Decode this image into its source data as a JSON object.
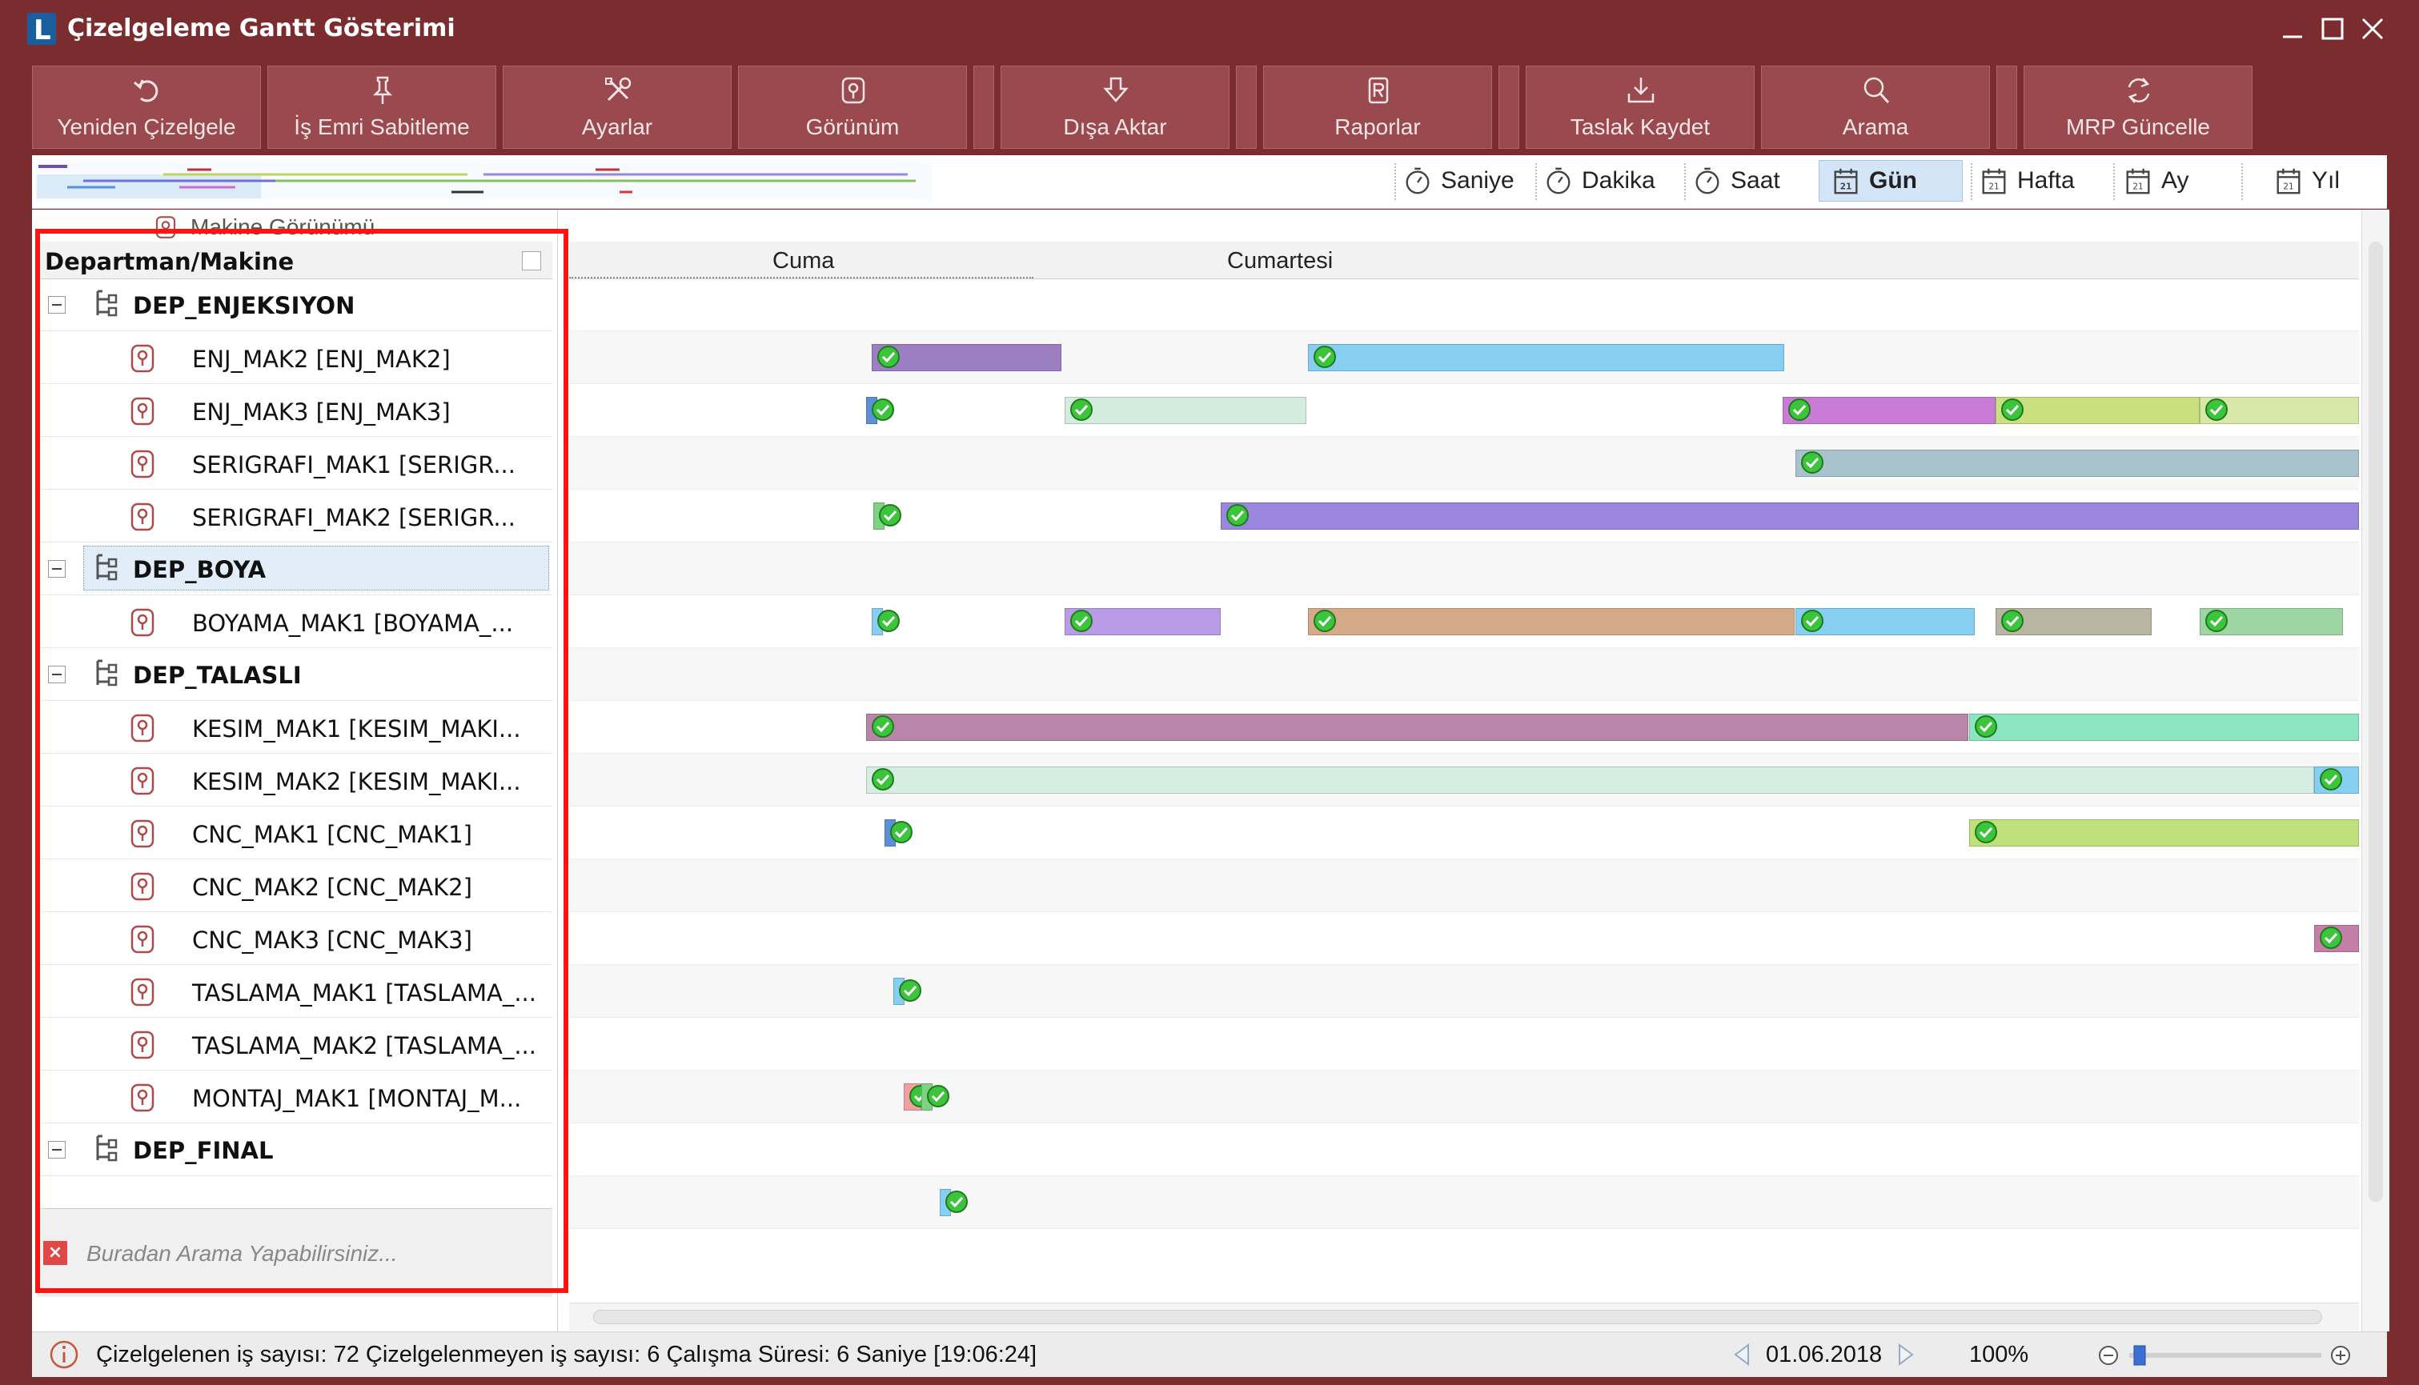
{
  "window": {
    "title": "Çizelgeleme Gantt Gösterimi",
    "logo_letter": "L"
  },
  "toolbar": {
    "buttons": [
      {
        "label": "Yeniden Çizelgele",
        "icon": "refresh-icon"
      },
      {
        "label": "İş Emri Sabitleme",
        "icon": "pin-icon"
      },
      {
        "label": "Ayarlar",
        "icon": "tools-icon"
      },
      {
        "label": "Görünüm",
        "icon": "view-icon"
      },
      {
        "label": "Dışa Aktar",
        "icon": "export-icon"
      },
      {
        "label": "Raporlar",
        "icon": "report-icon"
      },
      {
        "label": "Taslak Kaydet",
        "icon": "save-draft-icon"
      },
      {
        "label": "Arama",
        "icon": "search-icon"
      },
      {
        "label": "MRP Güncelle",
        "icon": "sync-icon"
      }
    ]
  },
  "scale": {
    "options": [
      "Saniye",
      "Dakika",
      "Saat",
      "Gün",
      "Hafta",
      "Ay",
      "Yıl"
    ],
    "selected": "Gün"
  },
  "tree": {
    "view_tab": "Makine Görünümü",
    "header": "Departman/Makine",
    "rows": [
      {
        "type": "dep",
        "label": "DEP_ENJEKSIYON"
      },
      {
        "type": "mak",
        "label": "ENJ_MAK2 [ENJ_MAK2]"
      },
      {
        "type": "mak",
        "label": "ENJ_MAK3 [ENJ_MAK3]"
      },
      {
        "type": "mak",
        "label": "SERIGRAFI_MAK1 [SERIGR..."
      },
      {
        "type": "mak",
        "label": "SERIGRAFI_MAK2 [SERIGR..."
      },
      {
        "type": "dep",
        "label": "DEP_BOYA",
        "selected": true
      },
      {
        "type": "mak",
        "label": "BOYAMA_MAK1 [BOYAMA_..."
      },
      {
        "type": "dep",
        "label": "DEP_TALASLI"
      },
      {
        "type": "mak",
        "label": "KESIM_MAK1 [KESIM_MAKI..."
      },
      {
        "type": "mak",
        "label": "KESIM_MAK2 [KESIM_MAKI..."
      },
      {
        "type": "mak",
        "label": "CNC_MAK1 [CNC_MAK1]"
      },
      {
        "type": "mak",
        "label": "CNC_MAK2 [CNC_MAK2]"
      },
      {
        "type": "mak",
        "label": "CNC_MAK3 [CNC_MAK3]"
      },
      {
        "type": "mak",
        "label": "TASLAMA_MAK1 [TASLAMA_..."
      },
      {
        "type": "mak",
        "label": "TASLAMA_MAK2 [TASLAMA_..."
      },
      {
        "type": "mak",
        "label": "MONTAJ_MAK1 [MONTAJ_M..."
      },
      {
        "type": "dep",
        "label": "DEP_FINAL"
      }
    ],
    "search_placeholder": "Buradan Arama Yapabilirsiniz..."
  },
  "gantt": {
    "days": [
      "Cuma",
      "Cumartesi"
    ],
    "rows": [
      [],
      [
        {
          "s": 0.169,
          "e": 0.275,
          "c": "#9b7fc2"
        },
        {
          "s": 0.413,
          "e": 0.679,
          "c": "#86cff2"
        }
      ],
      [
        {
          "s": 0.166,
          "e": 0.17,
          "c": "#5b8fd6"
        },
        {
          "s": 0.277,
          "e": 0.412,
          "c": "#d3ecdc"
        },
        {
          "s": 0.678,
          "e": 0.797,
          "c": "#c97bd6"
        },
        {
          "s": 0.797,
          "e": 0.911,
          "c": "#c8e07d"
        },
        {
          "s": 0.911,
          "e": 1.0,
          "c": "#d6e9a6"
        }
      ],
      [
        {
          "s": 0.685,
          "e": 1.0,
          "c": "#a9c3cc"
        }
      ],
      [
        {
          "s": 0.17,
          "e": 0.174,
          "c": "#7fd183"
        },
        {
          "s": 0.364,
          "e": 1.0,
          "c": "#9a86df"
        }
      ],
      [],
      [
        {
          "s": 0.169,
          "e": 0.173,
          "c": "#86cff2"
        },
        {
          "s": 0.277,
          "e": 0.364,
          "c": "#b99be6"
        },
        {
          "s": 0.413,
          "e": 0.685,
          "c": "#d4aa88"
        },
        {
          "s": 0.685,
          "e": 0.785,
          "c": "#86cff2"
        },
        {
          "s": 0.797,
          "e": 0.884,
          "c": "#b8b5a3"
        },
        {
          "s": 0.911,
          "e": 0.991,
          "c": "#9ed6a3"
        }
      ],
      [],
      [
        {
          "s": 0.166,
          "e": 0.782,
          "c": "#b886a8"
        },
        {
          "s": 0.782,
          "e": 1.0,
          "c": "#8be6c0"
        }
      ],
      [
        {
          "s": 0.166,
          "e": 0.975,
          "c": "#d6eee2"
        },
        {
          "s": 0.975,
          "e": 1.0,
          "c": "#86cff2"
        }
      ],
      [
        {
          "s": 0.176,
          "e": 0.18,
          "c": "#5b8fd6"
        },
        {
          "s": 0.782,
          "e": 1.0,
          "c": "#bfe07a"
        }
      ],
      [],
      [
        {
          "s": 0.975,
          "e": 1.0,
          "c": "#c47fa6"
        }
      ],
      [
        {
          "s": 0.181,
          "e": 0.185,
          "c": "#86cff2"
        }
      ],
      [],
      [
        {
          "s": 0.187,
          "e": 0.197,
          "c": "#f0a0a0"
        },
        {
          "s": 0.197,
          "e": 0.201,
          "c": "#7fd183"
        }
      ],
      [],
      [
        {
          "s": 0.207,
          "e": 0.213,
          "c": "#86cff2"
        }
      ]
    ]
  },
  "status": {
    "text": "Çizelgelenen iş sayısı: 72 Çizelgelenmeyen iş sayısı: 6 Çalışma Süresi: 6 Saniye [19:06:24]",
    "date": "01.06.2018",
    "zoom": "100%",
    "zoom_level": 0.05
  }
}
